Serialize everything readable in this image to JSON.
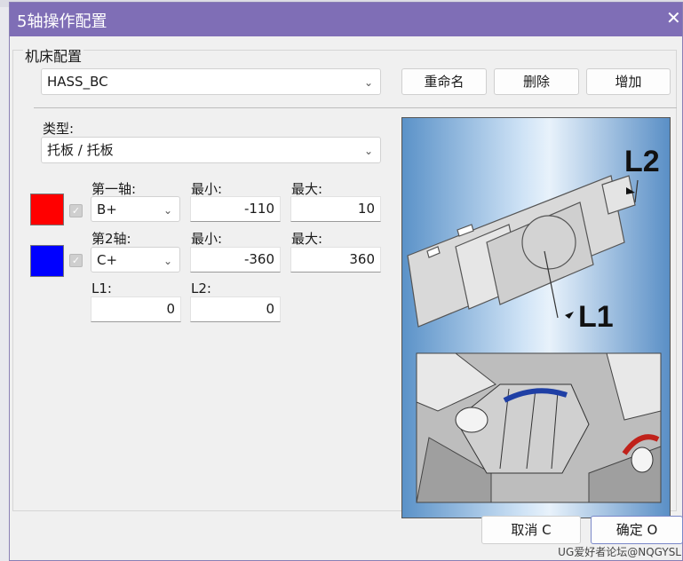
{
  "window": {
    "title": "5轴操作配置",
    "close_glyph": "✕"
  },
  "machine_group": {
    "legend": "机床配置",
    "machine": "HASS_BC",
    "rename_label": "重命名",
    "delete_label": "删除",
    "add_label": "增加"
  },
  "type": {
    "label": "类型:",
    "value": "托板 / 托板"
  },
  "axes": [
    {
      "color": "#ff0000",
      "label": "第一轴:",
      "axis": "B+",
      "min_label": "最小:",
      "min": "-110",
      "max_label": "最大:",
      "max": "10"
    },
    {
      "color": "#0000ff",
      "label": "第2轴:",
      "axis": "C+",
      "min_label": "最小:",
      "min": "-360",
      "max_label": "最大:",
      "max": "360"
    }
  ],
  "offsets": {
    "l1_label": "L1:",
    "l1": "0",
    "l2_label": "L2:",
    "l2": "0"
  },
  "preview": {
    "l1_text": "L1",
    "l2_text": "L2"
  },
  "footer": {
    "cancel_label": "取消 C",
    "ok_label": "确定 O",
    "watermark": "UG爱好者论坛@NQGYSL"
  },
  "icons": [
    "chevron-down-icon",
    "close-icon",
    "check-icon"
  ]
}
